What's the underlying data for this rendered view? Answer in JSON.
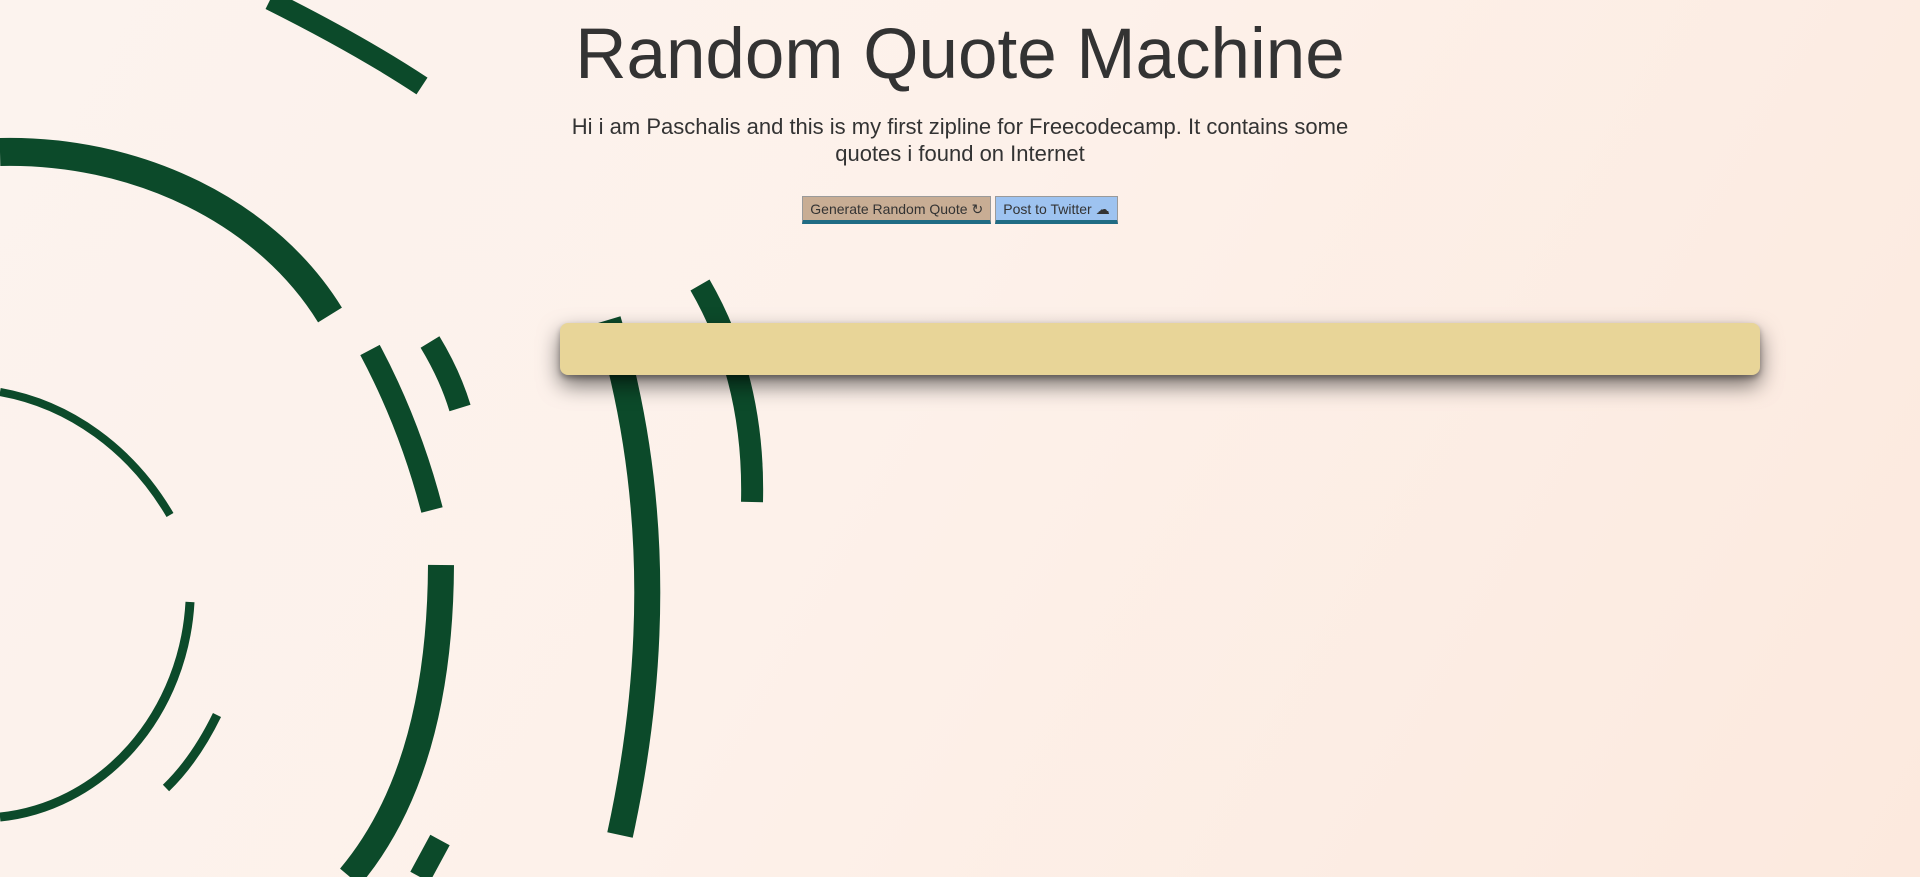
{
  "page": {
    "title": "Random Quote Machine",
    "intro": "Hi i am Paschalis and this is my first zipline for Freecodecamp. It contains some quotes i found on Internet"
  },
  "buttons": {
    "generate_label": "Generate Random Quote",
    "generate_icon": "refresh-icon",
    "twitter_label": "Post to Twitter",
    "twitter_icon": "cloud-upload-icon"
  },
  "quote": {
    "text": "",
    "author": ""
  },
  "colors": {
    "background": "#fdf1ea",
    "rings": "#0c4a2a",
    "quote_box": "#e8d598",
    "generate_button": "#c8ad94",
    "twitter_button": "#9ec3f0",
    "button_border_bottom": "#206c84",
    "text": "#333333"
  }
}
